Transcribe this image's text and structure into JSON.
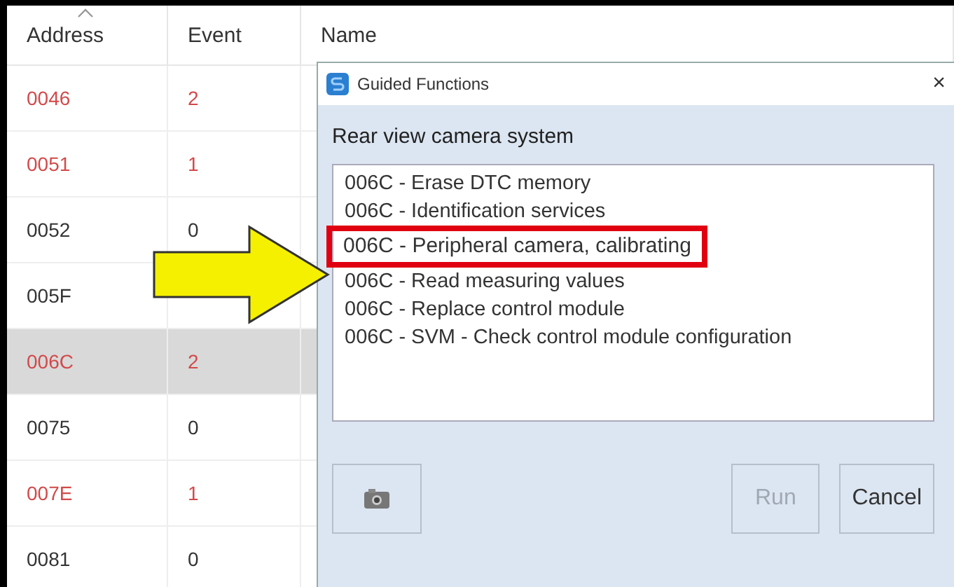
{
  "table": {
    "columns": [
      {
        "label": "Address",
        "sorted": true
      },
      {
        "label": "Event",
        "sorted": false
      },
      {
        "label": "Name",
        "sorted": false
      }
    ],
    "rows": [
      {
        "address": "0046",
        "event": "2",
        "fault": true,
        "selected": false
      },
      {
        "address": "0051",
        "event": "1",
        "fault": true,
        "selected": false
      },
      {
        "address": "0052",
        "event": "0",
        "fault": false,
        "selected": false
      },
      {
        "address": "005F",
        "event": "",
        "fault": false,
        "selected": false
      },
      {
        "address": "006C",
        "event": "2",
        "fault": true,
        "selected": true
      },
      {
        "address": "0075",
        "event": "0",
        "fault": false,
        "selected": false
      },
      {
        "address": "007E",
        "event": "1",
        "fault": true,
        "selected": false
      },
      {
        "address": "0081",
        "event": "0",
        "fault": false,
        "selected": false
      }
    ]
  },
  "dialog": {
    "title": "Guided Functions",
    "close": "×",
    "heading": "Rear view camera system",
    "functions": [
      {
        "label": "006C - Erase DTC memory",
        "highlighted": false
      },
      {
        "label": "006C - Identification services",
        "highlighted": false
      },
      {
        "label": "006C - Peripheral camera, calibrating",
        "highlighted": true
      },
      {
        "label": "006C - Read measuring values",
        "highlighted": false
      },
      {
        "label": "006C - Replace control module",
        "highlighted": false
      },
      {
        "label": "006C - SVM - Check control module configuration",
        "highlighted": false
      }
    ],
    "buttons": [
      {
        "label": "Run",
        "disabled": true
      },
      {
        "label": "Cancel",
        "disabled": false
      }
    ]
  }
}
